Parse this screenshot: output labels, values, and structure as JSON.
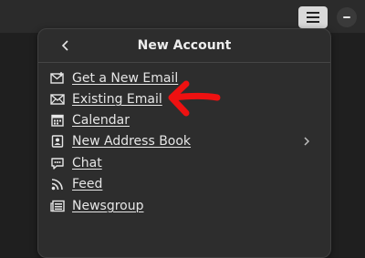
{
  "header": {
    "title": "New Account"
  },
  "menu": {
    "items": [
      {
        "label": "Get a New Email",
        "icon": "new-email-icon"
      },
      {
        "label": "Existing Email",
        "icon": "envelope-icon"
      },
      {
        "label": "Calendar",
        "icon": "calendar-icon"
      },
      {
        "label": "New Address Book",
        "icon": "address-book-icon",
        "has_submenu": true
      },
      {
        "label": "Chat",
        "icon": "chat-icon"
      },
      {
        "label": "Feed",
        "icon": "rss-icon"
      },
      {
        "label": "Newsgroup",
        "icon": "newsgroup-icon"
      }
    ]
  },
  "colors": {
    "background": "#1f1f1f",
    "panel": "#2d2d2d",
    "text": "#e6e6e6",
    "annotation_arrow": "#ee1111"
  }
}
